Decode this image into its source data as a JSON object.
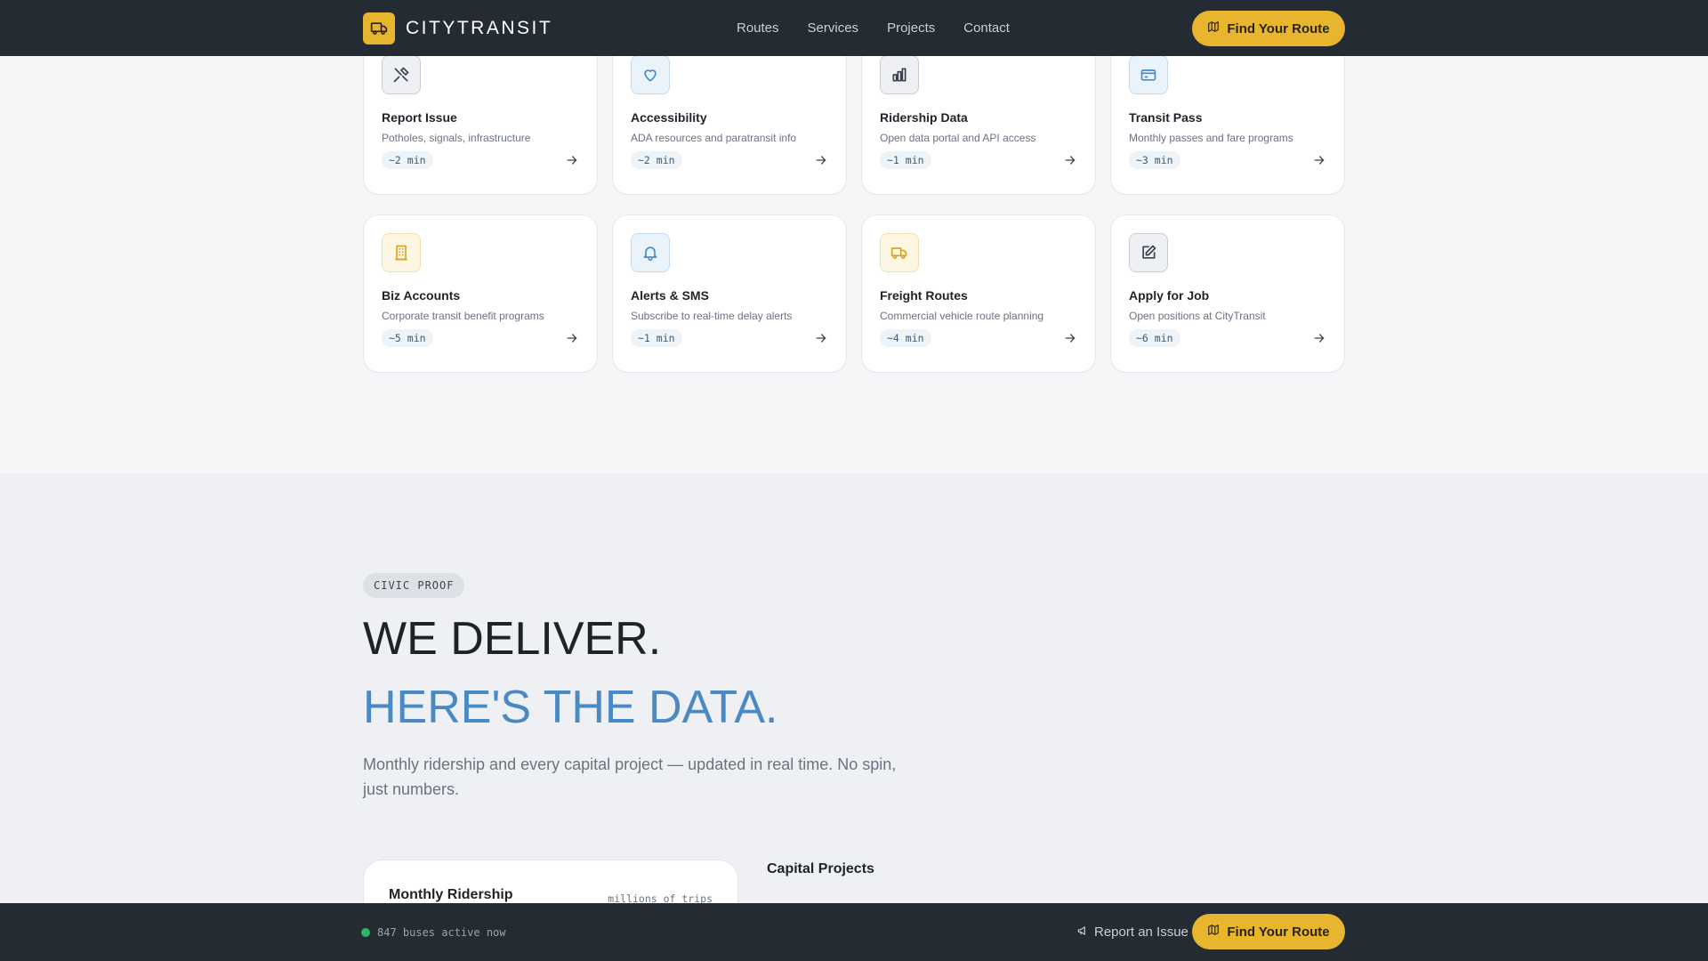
{
  "header": {
    "brand": "CITYTRANSIT",
    "nav": [
      "Routes",
      "Services",
      "Projects",
      "Contact"
    ],
    "cta_label": "Find Your Route"
  },
  "cards": [
    {
      "title": "Report Issue",
      "desc": "Potholes, signals, infrastructure",
      "time": "~2 min",
      "icon": "tools-icon"
    },
    {
      "title": "Accessibility",
      "desc": "ADA resources and paratransit info",
      "time": "~2 min",
      "icon": "heart-icon"
    },
    {
      "title": "Ridership Data",
      "desc": "Open data portal and API access",
      "time": "~1 min",
      "icon": "bar-chart-icon"
    },
    {
      "title": "Transit Pass",
      "desc": "Monthly passes and fare programs",
      "time": "~3 min",
      "icon": "card-icon"
    },
    {
      "title": "Biz Accounts",
      "desc": "Corporate transit benefit programs",
      "time": "~5 min",
      "icon": "building-icon"
    },
    {
      "title": "Alerts & SMS",
      "desc": "Subscribe to real-time delay alerts",
      "time": "~1 min",
      "icon": "bell-icon"
    },
    {
      "title": "Freight Routes",
      "desc": "Commercial vehicle route planning",
      "time": "~4 min",
      "icon": "truck-icon"
    },
    {
      "title": "Apply for Job",
      "desc": "Open positions at CityTransit",
      "time": "~6 min",
      "icon": "edit-icon"
    }
  ],
  "section": {
    "tag": "CIVIC PROOF",
    "heading_1": "WE DELIVER.",
    "heading_2": "HERE'S THE DATA.",
    "lead": "Monthly ridership and every capital project — updated in real time. No spin, just numbers.",
    "ridership_title": "Monthly Ridership",
    "ridership_unit": "millions of trips",
    "projects_title": "Capital Projects"
  },
  "footer": {
    "live_text": "847 buses active now",
    "report_label": "Report an Issue",
    "cta_label": "Find Your Route"
  },
  "colors": {
    "accent": "#e8b52f",
    "header_bg": "#252b33",
    "headline_blue": "#4a8ac4",
    "live_green": "#2eb866"
  }
}
